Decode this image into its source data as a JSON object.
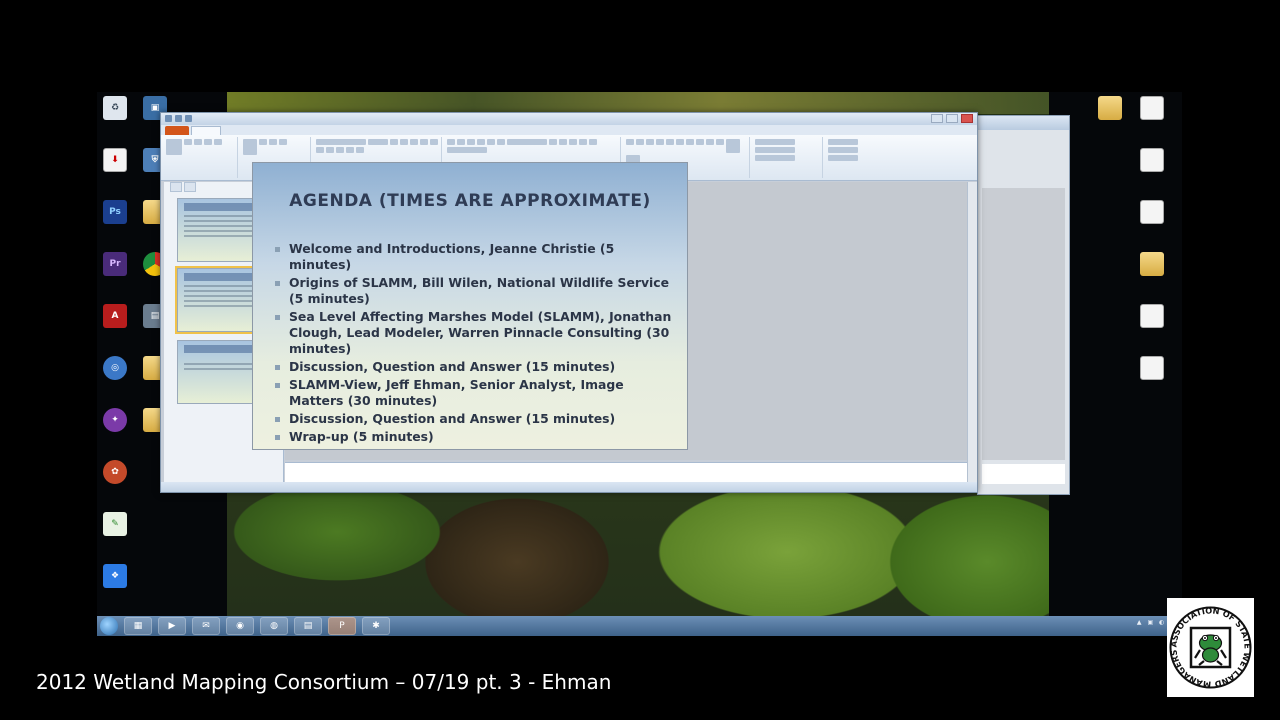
{
  "slide": {
    "title": "AGENDA (TIMES ARE APPROXIMATE)",
    "items": [
      "Welcome and Introductions, Jeanne Christie (5 minutes)",
      "Origins of SLAMM, Bill Wilen, National Wildlife Service (5 minutes)",
      "Sea Level Affecting Marshes Model (SLAMM), Jonathan Clough, Lead Modeler, Warren Pinnacle Consulting (30 minutes)",
      "Discussion, Question and Answer (15 minutes)",
      "SLAMM-View, Jeff Ehman, Senior Analyst, Image Matters (30 minutes)",
      "Discussion, Question and Answer (15 minutes)",
      "Wrap-up (5 minutes)"
    ]
  },
  "caption": "2012 Wetland Mapping Consortium – 07/19 pt. 3 - Ehman",
  "logo": {
    "ring_text": "ASSOCIATION OF STATE WETLAND MANAGERS"
  },
  "colors": {
    "slide_title": "#2f3c55",
    "slide_text": "#2b3547",
    "file_tab": "#d3551a",
    "logo_green": "#2e8b3a"
  }
}
